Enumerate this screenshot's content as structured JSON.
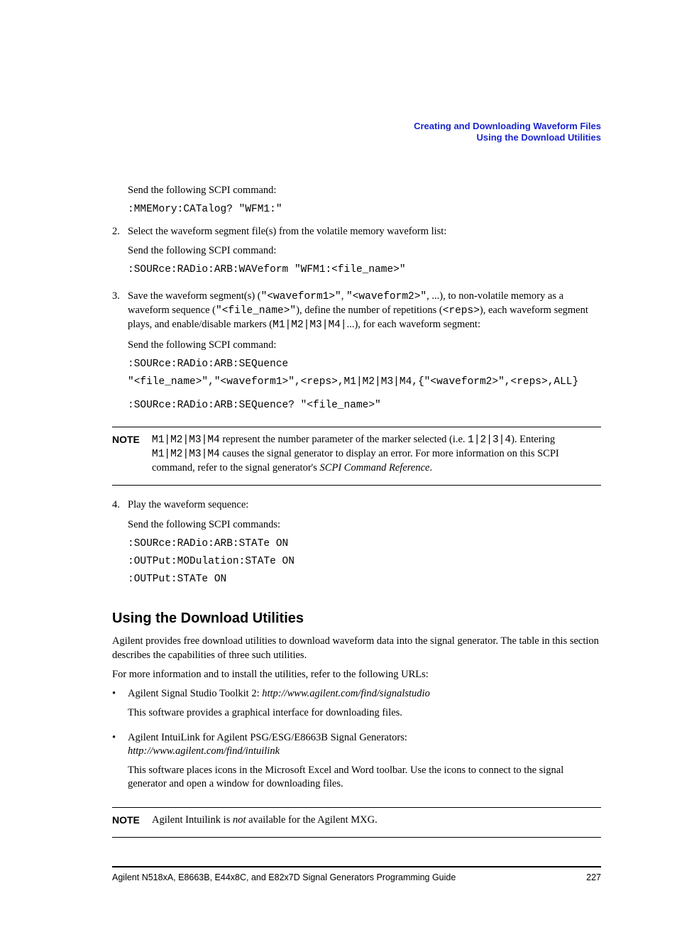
{
  "header": {
    "line1": "Creating and Downloading Waveform Files",
    "line2": "Using the Download Utilities"
  },
  "step1": {
    "send": "Send the following SCPI command:",
    "code": ":MMEMory:CATalog? \"WFM1:\""
  },
  "step2": {
    "num": "2.",
    "title": "Select the waveform segment file(s) from the volatile memory waveform list:",
    "send": "Send the following SCPI command:",
    "code": ":SOURce:RADio:ARB:WAVeform \"WFM1:<file_name>\""
  },
  "step3": {
    "num": "3.",
    "t1": "Save the waveform segment(s) (",
    "m1": "\"<waveform1>\"",
    "t2": ", ",
    "m2": "\"<waveform2>\"",
    "t3": ", ...), to non-volatile memory as a waveform sequence (",
    "m3": "\"<file_name>\"",
    "t4": "), define the number of repetitions (",
    "m4": "<reps>",
    "t5": "), each waveform segment plays, and enable/disable markers (",
    "m5": "M1|M2|M3|M4|",
    "t6": "...), for each waveform segment:",
    "send": "Send the following SCPI command:",
    "code1": ":SOURce:RADio:ARB:SEQuence",
    "code2": "\"<file_name>\",\"<waveform1>\",<reps>,M1|M2|M3|M4,{\"<waveform2>\",<reps>,ALL}",
    "code3": ":SOURce:RADio:ARB:SEQuence? \"<file_name>\""
  },
  "note1": {
    "label": "NOTE",
    "m1": "M1|M2|M3|M4",
    "t1": " represent the number parameter of the marker selected (i.e. ",
    "m2": "1|2|3|4",
    "t2": "). Entering ",
    "m3": "M1|M2|M3|M4",
    "t3": " causes the signal generator to display an error. For more information on this SCPI command, refer to the signal generator's ",
    "i1": "SCPI Command Reference",
    "t4": "."
  },
  "step4": {
    "num": "4.",
    "title": "Play the waveform sequence:",
    "send": "Send the following SCPI commands:",
    "code1": ":SOURce:RADio:ARB:STATe ON",
    "code2": ":OUTPut:MODulation:STATe ON",
    "code3": ":OUTPut:STATe ON"
  },
  "section": {
    "heading": "Using the Download Utilities",
    "p1": "Agilent provides free download utilities to download waveform data into the signal generator. The table in this section describes the capabilities of three such utilities.",
    "p2": "For more information and to install the utilities, refer to the following URLs:"
  },
  "bullets": {
    "b1a": "Agilent Signal Studio Toolkit 2: ",
    "b1b": "http://www.agilent.com/find/signalstudio",
    "b1c": "This software provides a graphical interface for downloading files.",
    "b2a": "Agilent IntuiLink for Agilent PSG/ESG/E8663B Signal Generators: ",
    "b2b": "http://www.agilent.com/find/intuilink",
    "b2c": "This software places icons in the Microsoft Excel and Word toolbar. Use the icons to connect to the signal generator and open a window for downloading files."
  },
  "note2": {
    "label": "NOTE",
    "t1": "Agilent Intuilink is ",
    "i1": "not",
    "t2": " available for the Agilent MXG."
  },
  "footer": {
    "left": "Agilent N518xA, E8663B, E44x8C, and E82x7D Signal Generators Programming Guide",
    "right": "227"
  }
}
